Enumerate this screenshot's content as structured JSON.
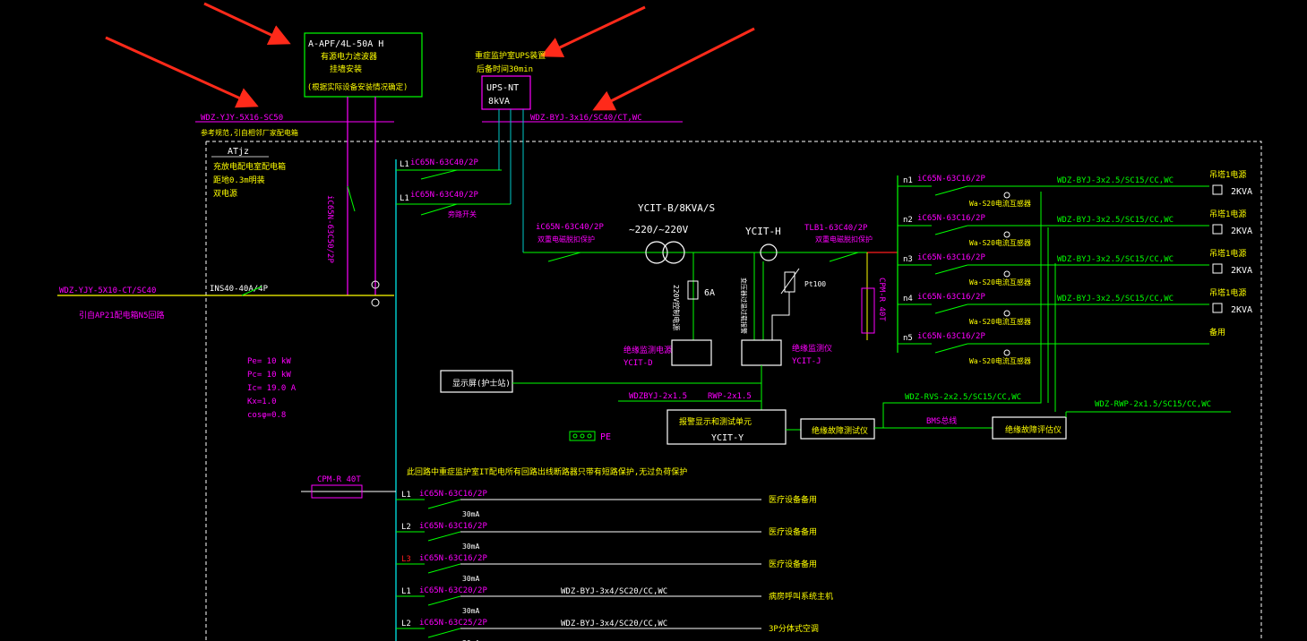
{
  "colors": {
    "background": "#000000",
    "white": "#ffffff",
    "green": "#00ff00",
    "cyan": "#00c8c8",
    "magenta": "#ff00ff",
    "yellow": "#ffff00",
    "red": "#ff1e1e",
    "dashed": "#ffffff",
    "arrow": "#ff2a1a"
  },
  "apf": {
    "title": "A-APF/4L-50A H",
    "line1": "有源电力滤波器",
    "line2": "挂墙安装",
    "line3": "(根据实际设备安装情况确定)"
  },
  "ups": {
    "note1": "重症监护室UPS装置",
    "note2": "后备时间30min",
    "model": "UPS-NT",
    "capacity": "8kVA",
    "cable": "WDZ-BYJ-3x16/SC40/CT,WC"
  },
  "incoming": {
    "cable_top": "WDZ-YJY-5X16-SC50",
    "cable_top_note": "参考规范,引自相邻厂家配电箱",
    "cable_main": "WDZ-YJY-5X10-CT/SC40",
    "source_note": "引自AP21配电箱N5回路",
    "isolator": "INS40-40A/4P",
    "breaker_vertical": "iC65N-63C50/2P"
  },
  "ats_note": {
    "title": "ATjz",
    "line1": "充放电配电室配电箱",
    "line2": "距地0.3m明装",
    "line3": "双电源"
  },
  "top_branches": [
    {
      "phase": "L1",
      "breaker": "iC65N-63C40/2P",
      "note": ""
    },
    {
      "phase": "L1",
      "breaker": "iC65N-63C40/2P",
      "note": "旁路开关"
    }
  ],
  "transformer": {
    "model": "YCIT-B/8KVA/S",
    "ratio": "~220/~220V",
    "ups_breaker": "iC65N-63C40/2P",
    "ups_breaker_note": "双重电磁脱扣保护",
    "detector": "YCIT-H",
    "out_breaker": "TLB1-63C40/2P",
    "out_breaker_note": "双重电磁脱扣保护",
    "fuse": "6A",
    "fuse_note": "220V控制电源",
    "pt_label": "Pt100",
    "temp_note": "变压器过温过载报警",
    "spd": "CPM-R 40T"
  },
  "modules": {
    "power": "绝缘监测电源",
    "power_model": "YCIT-D",
    "monitor": "绝缘监测仪",
    "monitor_model": "YCIT-J",
    "display": "显示屏(护士站)",
    "display_cable": "WDZBYJ-2x1.5",
    "display_cable2": "RWP-2x1.5",
    "central": "报警显示和测试单元",
    "central_model": "YCIT-Y",
    "locator": "绝缘故障测试仪",
    "evaluator": "绝缘故障评估仪",
    "bms": "BMS总线",
    "rvs_cable": "WDZ-RVS-2x2.5/SC15/CC,WC",
    "rwp_cable": "WDZ-RWP-2x1.5/SC15/CC,WC"
  },
  "right_circuits": [
    {
      "id": "n1",
      "breaker": "iC65N-63C16/2P",
      "sensor": "",
      "cable": "WDZ-BYJ-3x2.5/SC15/CC,WC",
      "load": "吊塔1电源",
      "kva": "2KVA"
    },
    {
      "id": "n2",
      "breaker": "iC65N-63C16/2P",
      "sensor": "Wa-S20电流互感器",
      "cable": "WDZ-BYJ-3x2.5/SC15/CC,WC",
      "load": "吊塔1电源",
      "kva": "2KVA"
    },
    {
      "id": "n3",
      "breaker": "iC65N-63C16/2P",
      "sensor": "Wa-S20电流互感器",
      "cable": "WDZ-BYJ-3x2.5/SC15/CC,WC",
      "load": "吊塔1电源",
      "kva": "2KVA"
    },
    {
      "id": "n4",
      "breaker": "iC65N-63C16/2P",
      "sensor": "Wa-S20电流互感器",
      "cable": "WDZ-BYJ-3x2.5/SC15/CC,WC",
      "load": "吊塔1电源",
      "kva": "2KVA"
    },
    {
      "id": "n5",
      "breaker": "iC65N-63C16/2P",
      "sensor": "Wa-S20电流互感器",
      "cable": "",
      "load": "备用",
      "kva": ""
    }
  ],
  "first_sensor": "Wa-S20电流互感器",
  "load_calc": {
    "pe": "Pe=  10  kW",
    "pc": "Pc=  10  kW",
    "ic": "Ic=  19.0     A",
    "kx": "Kx=1.0",
    "cos": "cosφ=0.8"
  },
  "pe_label": "PE",
  "bottom_note": "此回路中重症监护室IT配电所有回路出线断路器只带有短路保护,无过负荷保护",
  "bottom_spd": "CPM-R 40T",
  "bottom_circuits": [
    {
      "phase": "L1",
      "breaker": "iC65N-63C16/2P",
      "rcd": "30mA",
      "cable": "",
      "load": "医疗设备备用"
    },
    {
      "phase": "L2",
      "breaker": "iC65N-63C16/2P",
      "rcd": "30mA",
      "cable": "",
      "load": "医疗设备备用"
    },
    {
      "phase": "L3",
      "breaker": "iC65N-63C16/2P",
      "rcd": "30mA",
      "cable": "",
      "load": "医疗设备备用"
    },
    {
      "phase": "L1",
      "breaker": "iC65N-63C20/2P",
      "rcd": "30mA",
      "cable": "WDZ-BYJ-3x4/SC20/CC,WC",
      "load": "病房呼叫系统主机"
    },
    {
      "phase": "L2",
      "breaker": "iC65N-63C25/2P",
      "rcd": "30mA",
      "cable": "WDZ-BYJ-3x4/SC20/CC,WC",
      "load": "3P分体式空调"
    }
  ]
}
